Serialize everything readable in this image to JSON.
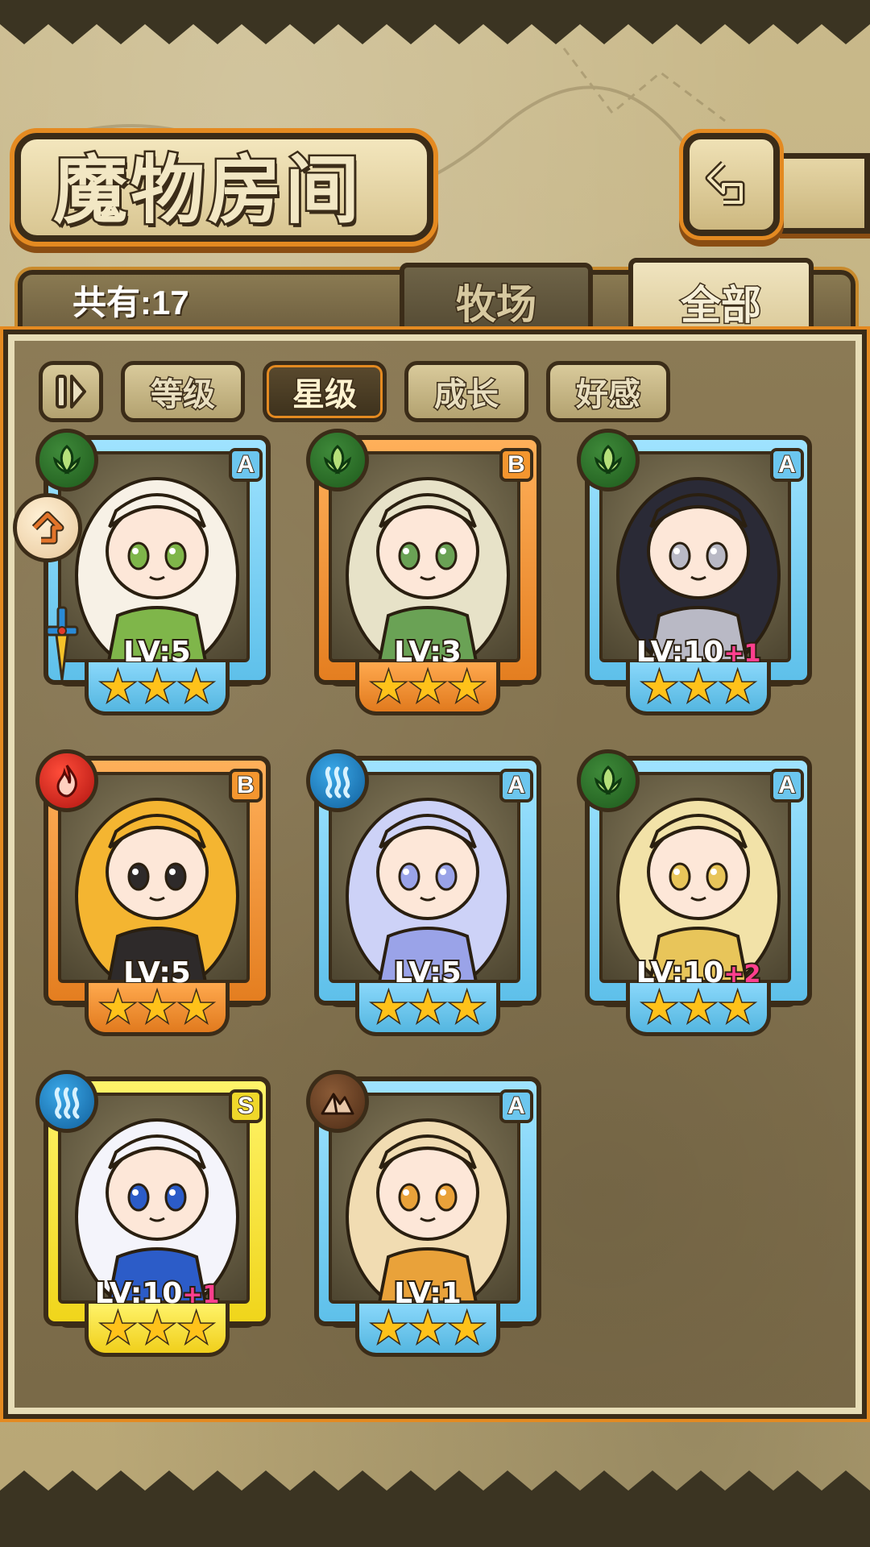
{
  "title": "魔物房间",
  "count_label": "共有:17",
  "tabs": [
    {
      "label": "牧场",
      "active": false
    },
    {
      "label": "全部",
      "active": true
    }
  ],
  "sort_buttons": [
    {
      "label": "等级",
      "active": false
    },
    {
      "label": "星级",
      "active": true
    },
    {
      "label": "成长",
      "active": false
    },
    {
      "label": "好感",
      "active": false
    }
  ],
  "monsters": [
    {
      "rank": "A",
      "element": "leaf-icon",
      "frame": "blue",
      "level": "LV:5",
      "plus": "",
      "stars": 3,
      "hair": "#f7f1e6",
      "accent": "#7fb64a"
    },
    {
      "rank": "B",
      "element": "leaf-icon",
      "frame": "orange",
      "level": "LV:3",
      "plus": "",
      "stars": 3,
      "hair": "#e7e2c8",
      "accent": "#6aa255"
    },
    {
      "rank": "A",
      "element": "leaf-icon",
      "frame": "blue",
      "level": "LV:10",
      "plus": "+1",
      "stars": 3,
      "hair": "#2a2a36",
      "accent": "#b9b9c5"
    },
    {
      "rank": "B",
      "element": "fire-icon",
      "frame": "orange",
      "level": "LV:5",
      "plus": "",
      "stars": 3,
      "hair": "#f4b531",
      "accent": "#2e2a2a"
    },
    {
      "rank": "A",
      "element": "water-icon",
      "frame": "blue",
      "level": "LV:5",
      "plus": "",
      "stars": 3,
      "hair": "#cdd2f7",
      "accent": "#9aa3e8"
    },
    {
      "rank": "A",
      "element": "leaf-icon",
      "frame": "blue",
      "level": "LV:10",
      "plus": "+2",
      "stars": 3,
      "hair": "#f2e2a8",
      "accent": "#e8c55a"
    },
    {
      "rank": "S",
      "element": "water-icon",
      "frame": "yellow",
      "level": "LV:10",
      "plus": "+1",
      "stars": 3,
      "hair": "#f4f4fb",
      "accent": "#2c5cc8"
    },
    {
      "rank": "A",
      "element": "earth-icon",
      "frame": "blue",
      "level": "LV:1",
      "plus": "",
      "stars": 3,
      "hair": "#f1dcb2",
      "accent": "#e9a23a"
    }
  ],
  "colors": {
    "frame_blue": "#5ec0ea",
    "frame_orange": "#e47e20",
    "frame_yellow": "#f0d51b",
    "star": "#ffc21a",
    "plus": "#ff3f8e",
    "accent_orange": "#e48a21"
  }
}
